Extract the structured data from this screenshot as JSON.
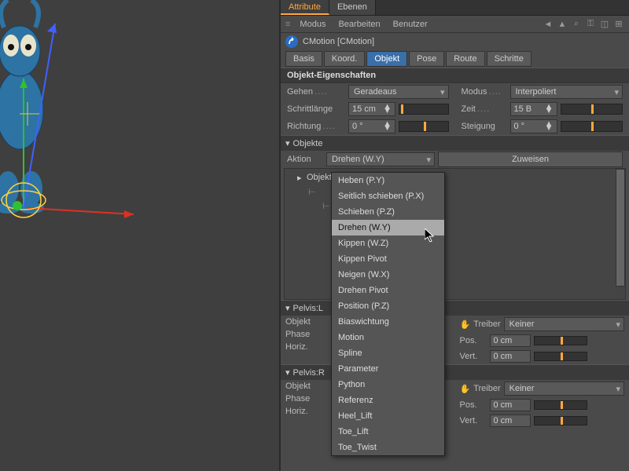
{
  "tabs": {
    "attribute": "Attribute",
    "ebenen": "Ebenen"
  },
  "menus": {
    "modus": "Modus",
    "bearbeiten": "Bearbeiten",
    "benutzer": "Benutzer"
  },
  "object_header": "CMotion [CMotion]",
  "subtabs": {
    "basis": "Basis",
    "koord": "Koord.",
    "objekt": "Objekt",
    "pose": "Pose",
    "route": "Route",
    "schritte": "Schritte"
  },
  "section_title": "Objekt-Eigenschaften",
  "fields": {
    "gehen_label": "Gehen",
    "gehen_value": "Geradeaus",
    "modus_label": "Modus",
    "modus_value": "Interpoliert",
    "schrittlaenge_label": "Schrittlänge",
    "schrittlaenge_value": "15 cm",
    "zeit_label": "Zeit",
    "zeit_value": "15 B",
    "richtung_label": "Richtung",
    "richtung_value": "0 °",
    "steigung_label": "Steigung",
    "steigung_value": "0 °"
  },
  "objekte_label": "Objekte",
  "aktion_label": "Aktion",
  "aktion_value": "Drehen (W.Y)",
  "zuweisen_btn": "Zuweisen",
  "tree": {
    "root": "Objekt"
  },
  "pelvis1_label": "Pelvis:L",
  "pelvis2_label": "Pelvis:R",
  "row_labels": {
    "objekt": "Objekt",
    "treiber": "Treiber",
    "keiner": "Keiner",
    "phase": "Phase",
    "pos": "Pos.",
    "vert": "Vert.",
    "horiz": "Horiz.",
    "val_cm": "0 cm"
  },
  "popup": {
    "items": [
      "Heben (P.Y)",
      "Seitlich schieben (P.X)",
      "Schieben (P.Z)",
      "Drehen (W.Y)",
      "Kippen (W.Z)",
      "Kippen Pivot",
      "Neigen (W.X)",
      "Drehen Pivot",
      "Position (P.Z)",
      "Biaswichtung",
      "Motion",
      "Spline",
      "Parameter",
      "Python",
      "Referenz",
      "Heel_Lift",
      "Toe_Lift",
      "Toe_Twist"
    ],
    "highlighted": "Drehen (W.Y)"
  }
}
